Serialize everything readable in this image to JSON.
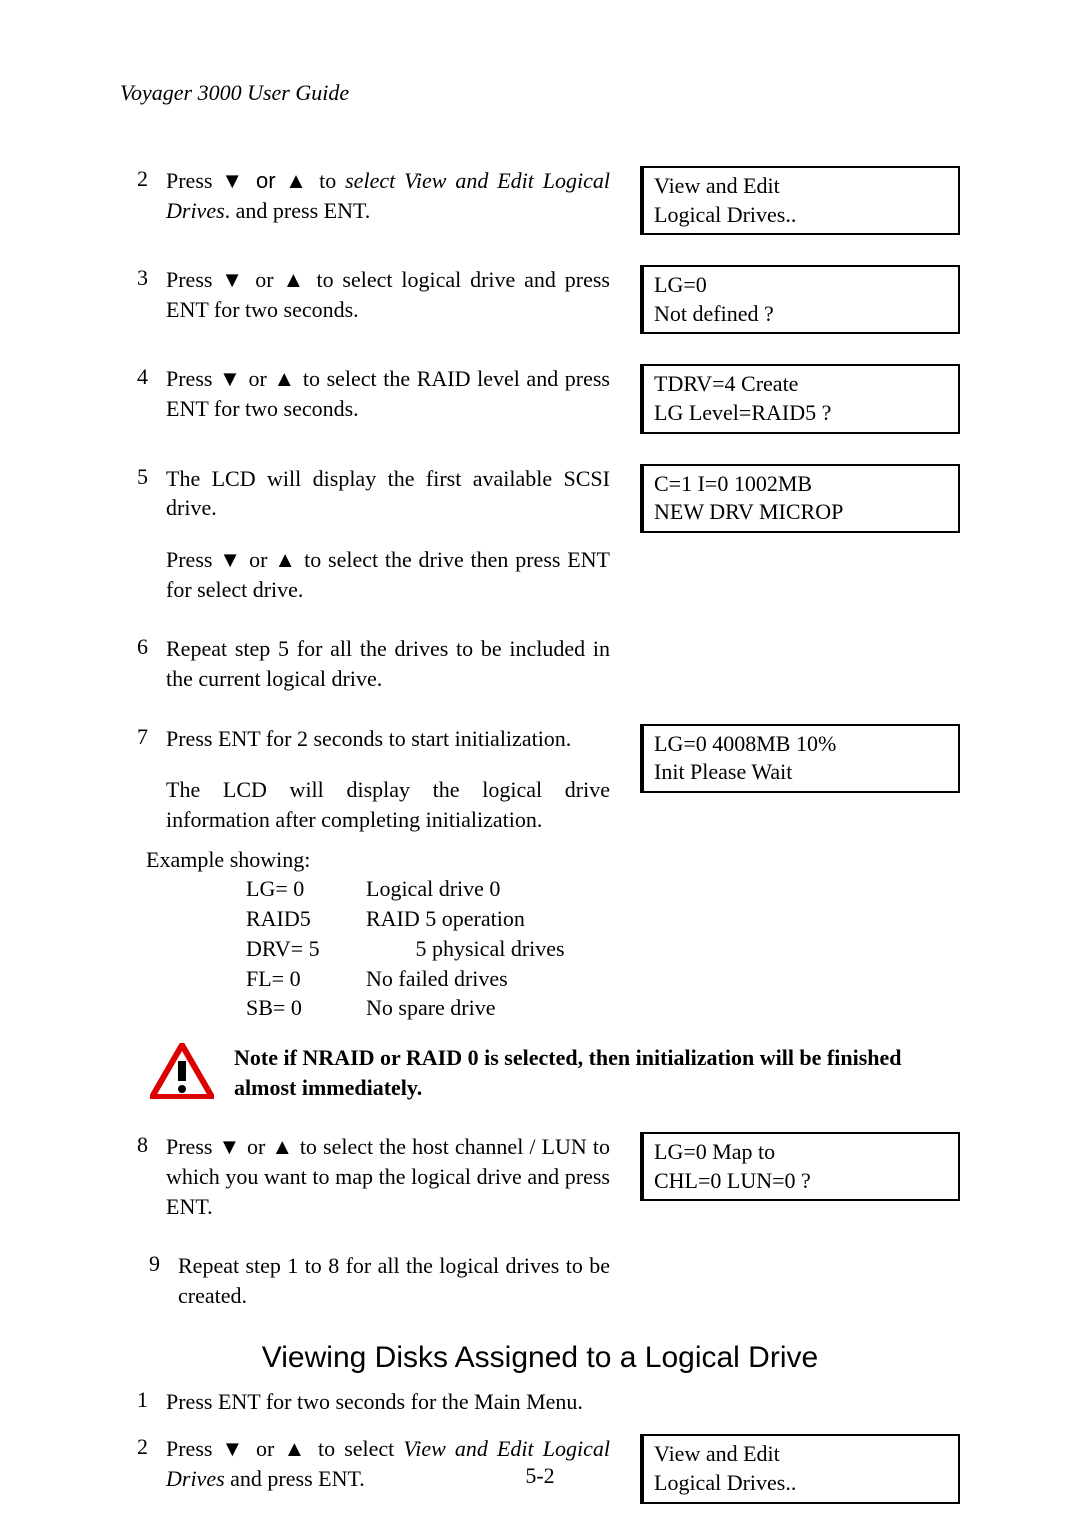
{
  "header": "Voyager 3000 User Guide",
  "steps": {
    "s2": {
      "num": "2",
      "pre": "Press ",
      "arrows": "▼ or ▲",
      "mid": " to ",
      "italic": "select View and Edit Logical Drives",
      "post": ". and press ENT."
    },
    "s3": {
      "num": "3",
      "text": "Press ▼ or ▲ to select logical drive and press ENT for two seconds."
    },
    "s4": {
      "num": "4",
      "text": "Press ▼ or ▲ to select the RAID level and press ENT for two seconds."
    },
    "s5": {
      "num": "5",
      "text": "The LCD will display the first available SCSI drive."
    },
    "s5b": "Press ▼ or ▲ to select the drive then press ENT for select drive.",
    "s6": {
      "num": "6",
      "text": "Repeat step 5 for all the drives to be included in the current logical drive."
    },
    "s7": {
      "num": "7",
      "text": "Press ENT for 2 seconds to start initialization."
    },
    "s7b": "The LCD will display the logical drive information after completing initialization.",
    "example_intro": "Example showing:",
    "example": [
      {
        "key": "LG= 0",
        "val": "Logical drive 0"
      },
      {
        "key": "RAID5",
        "val": "RAID 5 operation"
      },
      {
        "key": "DRV= 5",
        "val": "         5 physical drives"
      },
      {
        "key": "FL= 0",
        "val": "No failed drives"
      },
      {
        "key": "SB= 0",
        "val": "No spare drive"
      }
    ],
    "s8": {
      "num": "8",
      "text": "Press ▼ or ▲ to select the host channel / LUN to which you want to map the logical drive and press ENT."
    },
    "s9": {
      "num": "9",
      "text": "Repeat step 1 to 8 for all the logical drives to be created."
    },
    "v1": {
      "num": "1",
      "text": "Press ENT for two seconds for the Main Menu."
    },
    "v2": {
      "num": "2",
      "pre": "Press ▼ or ▲ to select ",
      "italic": "View and Edit Logical Drives",
      "post": " and press ENT."
    }
  },
  "lcd": {
    "l2a": "View and Edit",
    "l2b": "Logical Drives..",
    "l3a": "LG=0",
    "l3b": "Not defined   ?",
    "l4a": "TDRV=4 Create",
    "l4b": "LG Level=RAID5  ?",
    "l5a": "C=1 I=0 1002MB",
    "l5b": "NEW DRV MICROP",
    "l7a": "LG=0 4008MB 10%",
    "l7b": "Init Please Wait",
    "l8a": "LG=0 Map to",
    "l8b": "CHL=0 LUN=0   ?",
    "lv2a": "View and Edit",
    "lv2b": "Logical Drives.."
  },
  "note": "Note if NRAID or RAID 0 is selected, then initialization will be finished almost immediately.",
  "section_title": "Viewing Disks Assigned to a Logical Drive",
  "page_num": "5-2"
}
